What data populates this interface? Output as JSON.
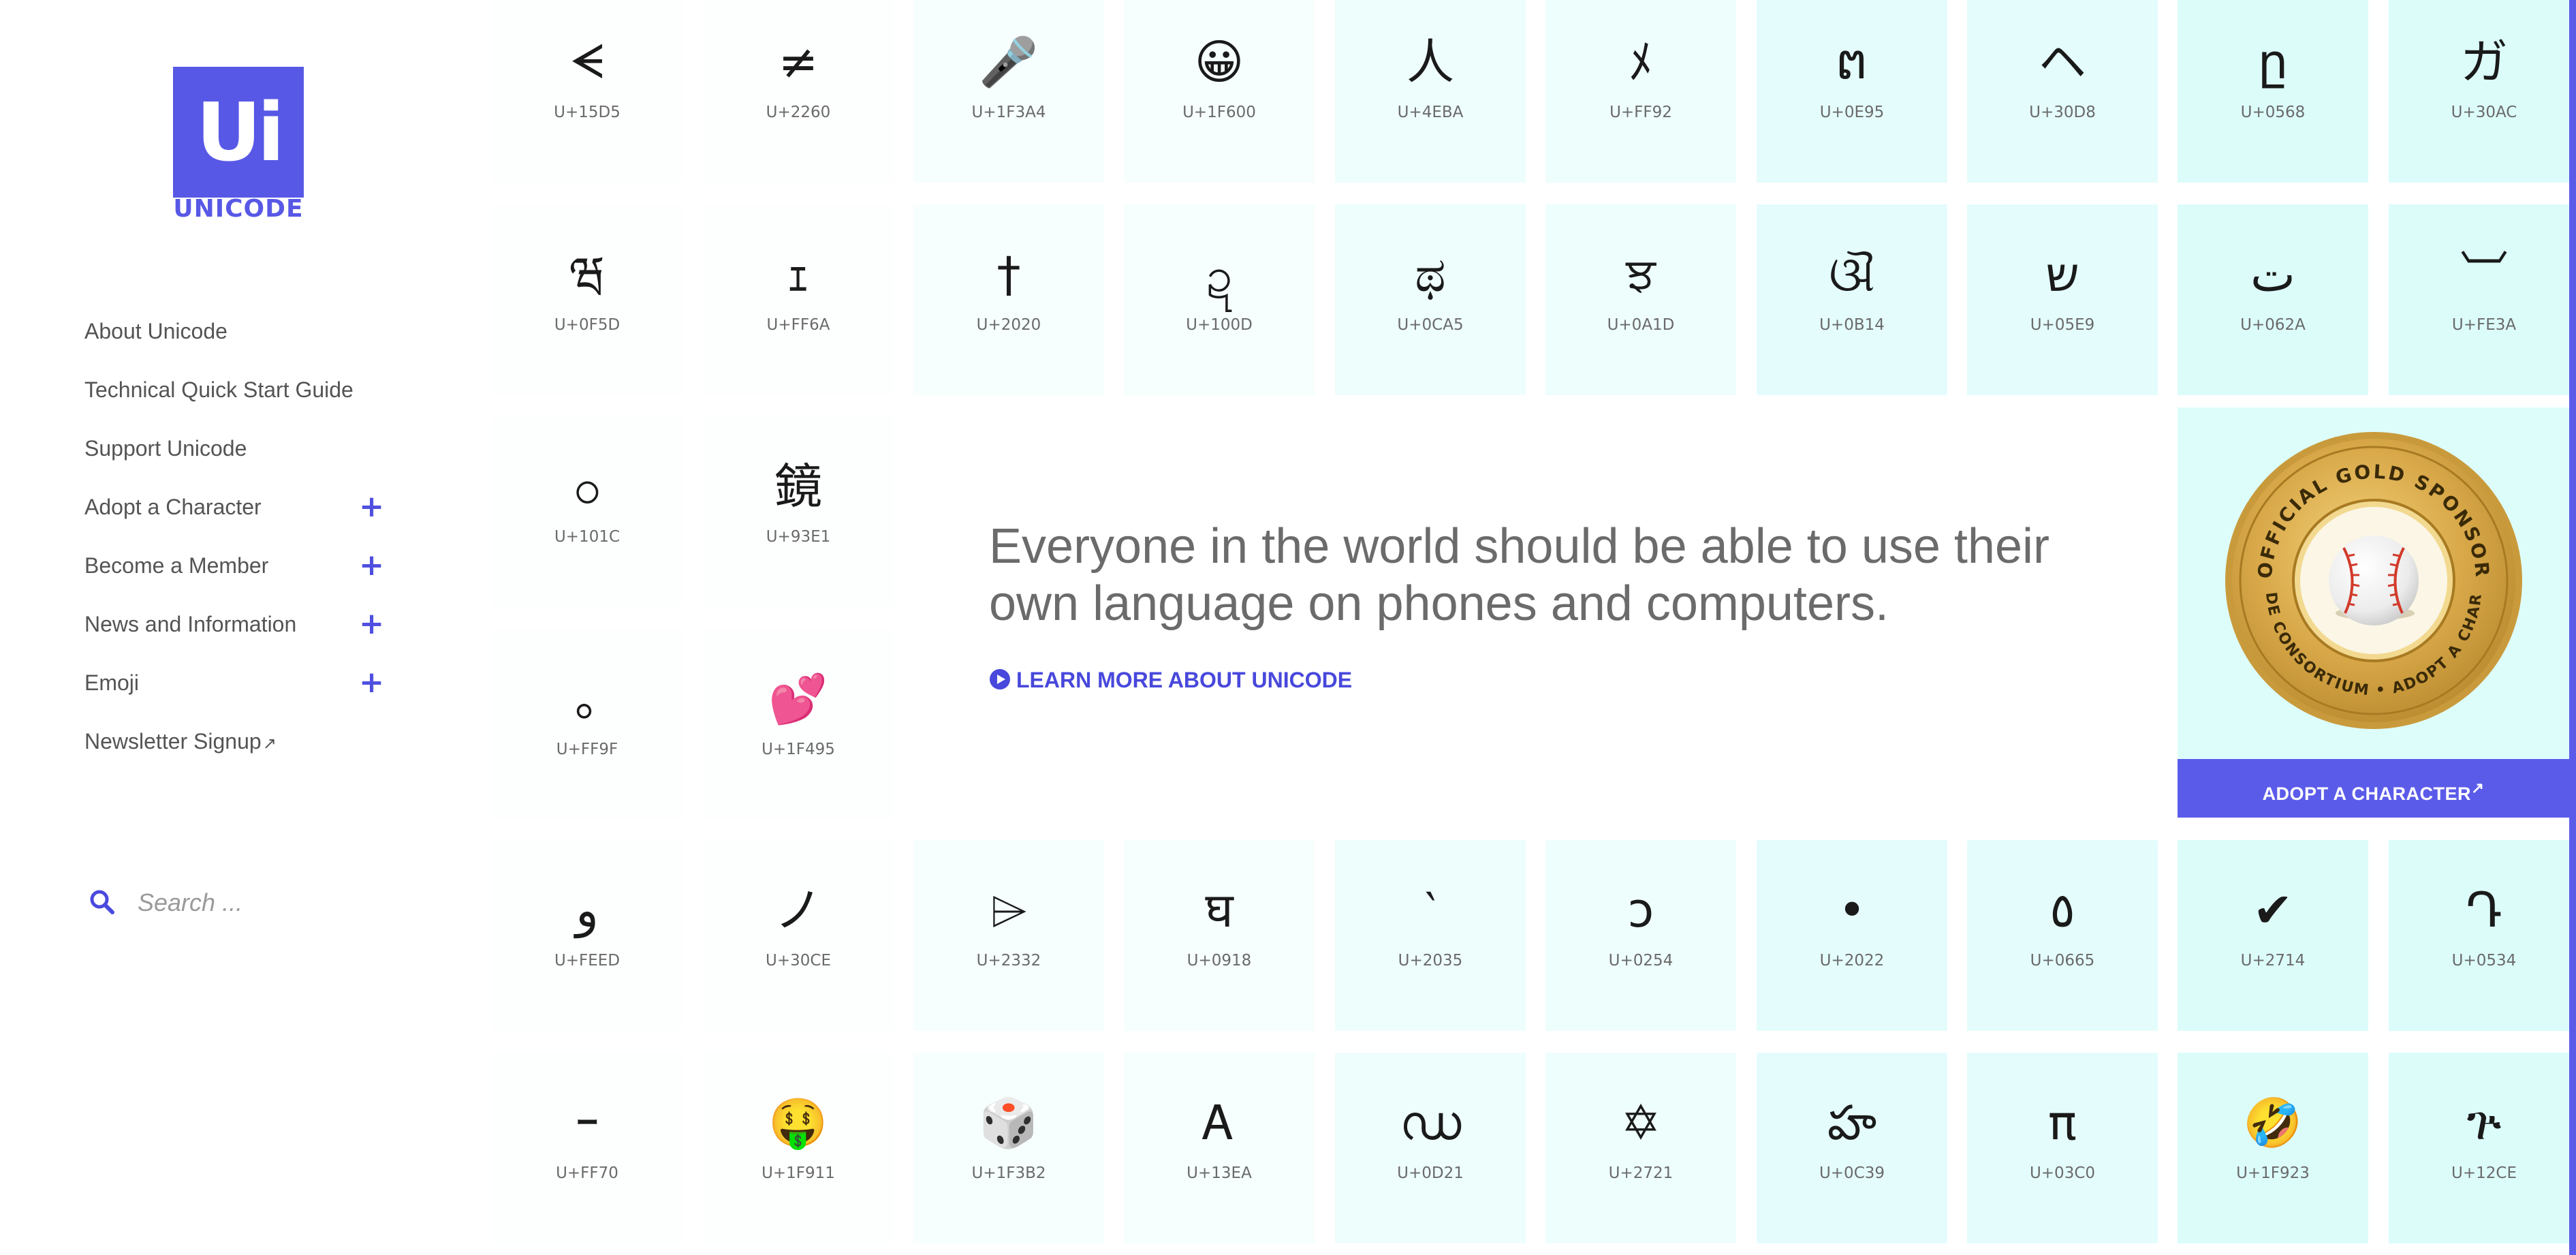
{
  "brand": {
    "logo_letters": "Ui",
    "logo_word": "UNICODE",
    "accent": "#5b5bea"
  },
  "nav": [
    {
      "label": "About Unicode",
      "expandable": false
    },
    {
      "label": "Technical Quick Start Guide",
      "expandable": false
    },
    {
      "label": "Support Unicode",
      "expandable": false
    },
    {
      "label": "Adopt a Character",
      "expandable": true
    },
    {
      "label": "Become a Member",
      "expandable": true
    },
    {
      "label": "News and Information",
      "expandable": true
    },
    {
      "label": "Emoji",
      "expandable": true
    },
    {
      "label": "Newsletter Signup",
      "external": true
    }
  ],
  "nav_expand_symbol": "+",
  "external_symbol": "↗",
  "search": {
    "placeholder": "Search ...",
    "icon": "search-icon"
  },
  "hero": {
    "headline": "Everyone in the world should be able to use their own language on phones and computers.",
    "cta": "LEARN MORE ABOUT UNICODE",
    "cta_icon": "play-circle-icon"
  },
  "sponsor": {
    "badge_top_text": "OFFICIAL GOLD SPONSOR",
    "badge_bottom_text": "UNICODE CONSORTIUM • ADOPT A CHARACTER",
    "badge_image": "baseball",
    "button": "ADOPT A CHARACTER"
  },
  "tile_colors": [
    "#fdfefe",
    "#f6fefe",
    "#eefefd",
    "#e4fdfc",
    "#dcfcfa"
  ],
  "tiles": [
    {
      "glyph": "ᗕ",
      "code": "U+15D5"
    },
    {
      "glyph": "≠",
      "code": "U+2260"
    },
    {
      "glyph": "🎤",
      "code": "U+1F3A4"
    },
    {
      "glyph": "😀",
      "code": "U+1F600"
    },
    {
      "glyph": "人",
      "code": "U+4EBA"
    },
    {
      "glyph": "ﾒ",
      "code": "U+FF92"
    },
    {
      "glyph": "ຕ",
      "code": "U+0E95"
    },
    {
      "glyph": "ヘ",
      "code": "U+30D8"
    },
    {
      "glyph": "ը",
      "code": "U+0568"
    },
    {
      "glyph": "ガ",
      "code": "U+30AC"
    },
    {
      "glyph": "ཝ",
      "code": "U+0F5D"
    },
    {
      "glyph": "ｪ",
      "code": "U+FF6A"
    },
    {
      "glyph": "†",
      "code": "U+2020"
    },
    {
      "glyph": "ဍ",
      "code": "U+100D"
    },
    {
      "glyph": "ಥ",
      "code": "U+0CA5"
    },
    {
      "glyph": "ਝ",
      "code": "U+0A1D"
    },
    {
      "glyph": "ଔ",
      "code": "U+0B14"
    },
    {
      "glyph": "ש",
      "code": "U+05E9"
    },
    {
      "glyph": "ت",
      "code": "U+062A"
    },
    {
      "glyph": "︺",
      "code": "U+FE3A"
    },
    {
      "glyph": "ဝ",
      "code": "U+101C"
    },
    {
      "glyph": "鏡",
      "code": "U+93E1"
    },
    {
      "glyph": "｡",
      "code": "U+FF9F"
    },
    {
      "glyph": "💕",
      "code": "U+1F495"
    },
    {
      "glyph": "ﻭ",
      "code": "U+FEED"
    },
    {
      "glyph": "ノ",
      "code": "U+30CE"
    },
    {
      "glyph": "⌲",
      "code": "U+2332"
    },
    {
      "glyph": "घ",
      "code": "U+0918"
    },
    {
      "glyph": "‵",
      "code": "U+2035"
    },
    {
      "glyph": "ɔ",
      "code": "U+0254"
    },
    {
      "glyph": "•",
      "code": "U+2022"
    },
    {
      "glyph": "٥",
      "code": "U+0665"
    },
    {
      "glyph": "✔",
      "code": "U+2714"
    },
    {
      "glyph": "Դ",
      "code": "U+0534"
    },
    {
      "glyph": "ｰ",
      "code": "U+FF70"
    },
    {
      "glyph": "🤑",
      "code": "U+1F911"
    },
    {
      "glyph": "🎲",
      "code": "U+1F3B2"
    },
    {
      "glyph": "Ꭺ",
      "code": "U+13EA"
    },
    {
      "glyph": "ഡ",
      "code": "U+0D21"
    },
    {
      "glyph": "✡",
      "code": "U+2721"
    },
    {
      "glyph": "హ",
      "code": "U+0C39"
    },
    {
      "glyph": "π",
      "code": "U+03C0"
    },
    {
      "glyph": "🤣",
      "code": "U+1F923"
    },
    {
      "glyph": "ጕ",
      "code": "U+12CE"
    }
  ]
}
